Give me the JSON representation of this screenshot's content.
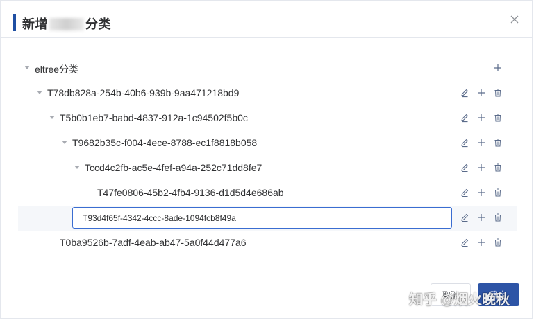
{
  "dialog": {
    "title_prefix": "新增",
    "title_suffix": "分类",
    "close_label": "×"
  },
  "tree": {
    "root": {
      "label": "eltree分类"
    },
    "nodes": [
      {
        "label": "T78db828a-254b-40b6-939b-9aa471218bd9"
      },
      {
        "label": "T5b0b1eb7-babd-4837-912a-1c94502f5b0c"
      },
      {
        "label": "T9682b35c-f004-4ece-8788-ec1f8818b058"
      },
      {
        "label": "Tccd4c2fb-ac5e-4fef-a94a-252c71dd8fe7"
      },
      {
        "label": "T47fe0806-45b2-4fb4-9136-d1d5d4e686ab"
      },
      {
        "label": "T93d4f65f-4342-4ccc-8ade-1094fcb8f49a",
        "editing": true
      },
      {
        "label": "T0ba9526b-7adf-4eab-ab47-5a0f44d477a6"
      }
    ]
  },
  "footer": {
    "cancel_label": "取消",
    "confirm_label": "确定"
  },
  "watermark": "知乎 @烟火晚秋",
  "colors": {
    "accent": "#1f4fa3",
    "primary_button": "#2d54a6",
    "input_focus_border": "#3a6dd1",
    "icon": "#5a6b8a"
  }
}
